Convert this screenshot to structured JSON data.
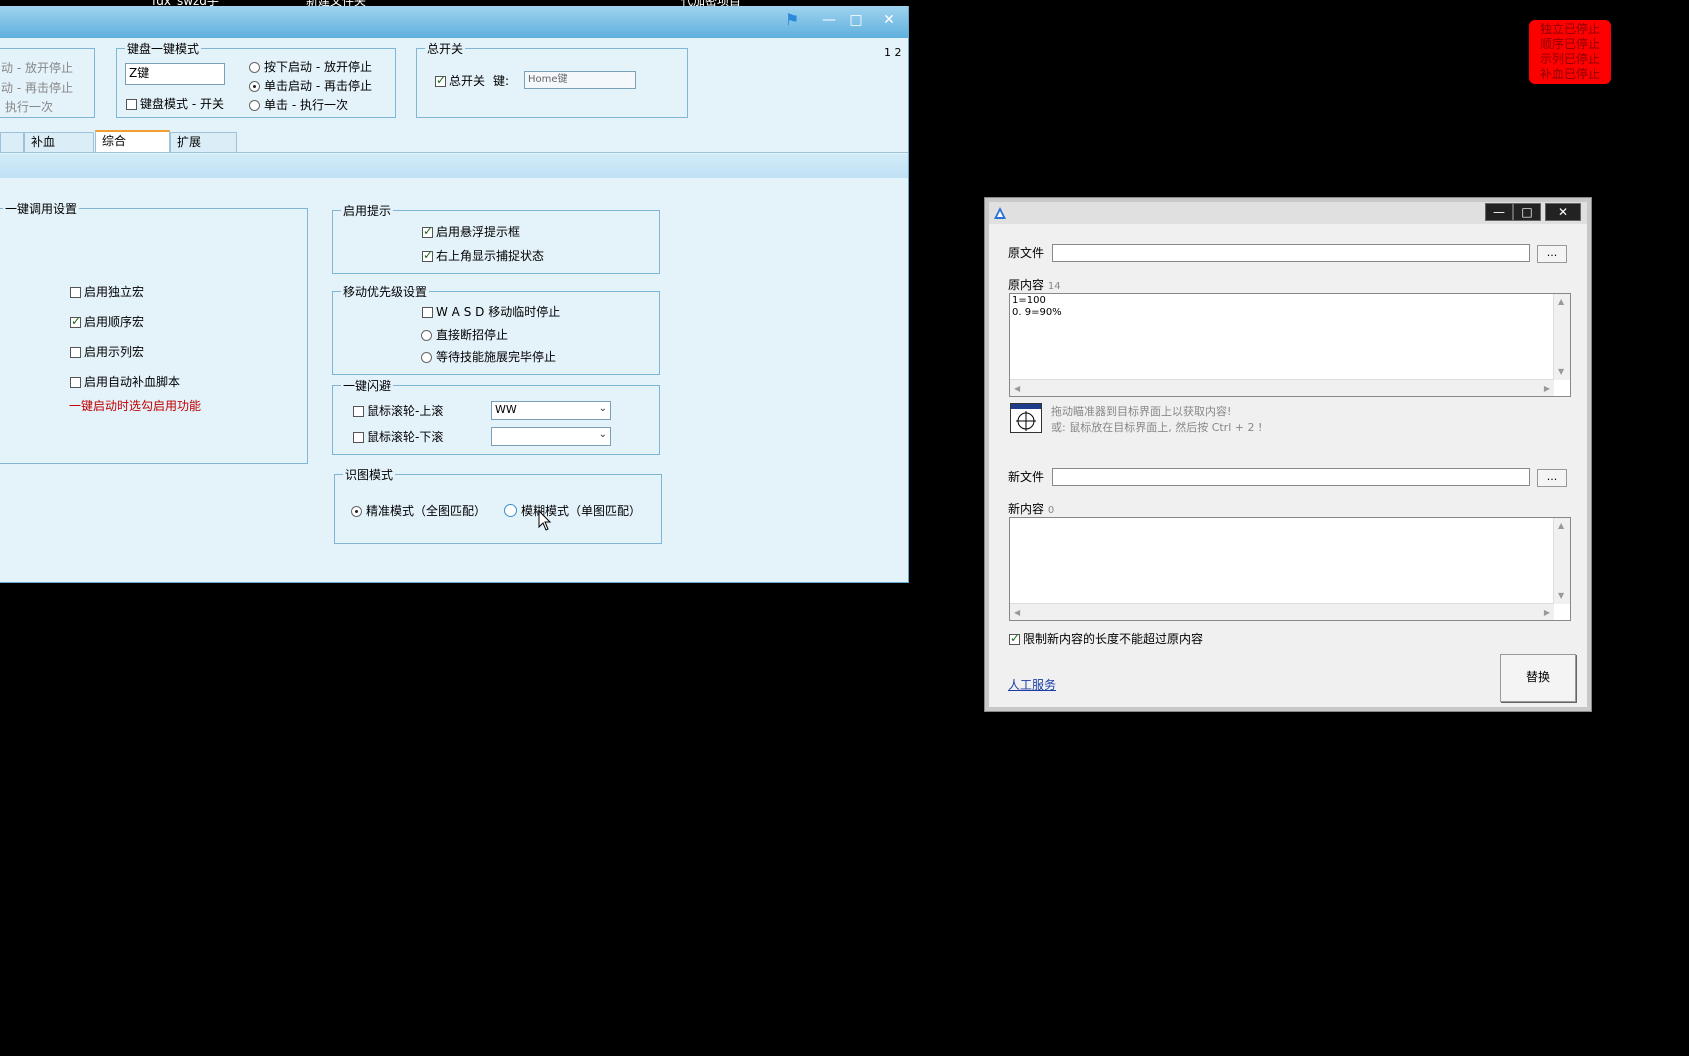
{
  "desktop": {
    "icon_labels": [
      "fdx_swzd手",
      "新建文件夹",
      "代加密项目"
    ]
  },
  "status_box": {
    "lines": [
      "独立已停止",
      "顺序已停止",
      "示列已停止",
      "补血已停止"
    ]
  },
  "main_window": {
    "page_indicator": "1 2",
    "left_group": {
      "lines": [
        "动 - 放开停止",
        "动 - 再击停止",
        "执行一次"
      ]
    },
    "keyboard_group": {
      "title": "键盘一键模式",
      "key_value": "Z键",
      "mode_checkbox": "键盘模式 - 开关",
      "mode_checked": false,
      "radio_press": "按下启动 - 放开停止",
      "radio_click": "单击启动 - 再击停止",
      "radio_once": "单击 - 执行一次",
      "selected": "radio_click"
    },
    "master_group": {
      "title": "总开关",
      "checkbox_label": "总开关",
      "checked": true,
      "key_label": "键:",
      "key_value": "Home键"
    },
    "tabs": [
      {
        "label": ""
      },
      {
        "label": "补血"
      },
      {
        "label": "综合",
        "active": true
      },
      {
        "label": "扩展"
      }
    ],
    "onekey_group": {
      "title": "一键调用设置",
      "items": [
        {
          "label": "启用独立宏",
          "checked": false
        },
        {
          "label": "启用顺序宏",
          "checked": true
        },
        {
          "label": "启用示列宏",
          "checked": false
        },
        {
          "label": "启用自动补血脚本",
          "checked": false
        }
      ],
      "note": "一键启动时选勾启用功能",
      "note_color": "#c00000"
    },
    "hint_group": {
      "title": "启用提示",
      "items": [
        {
          "label": "启用悬浮提示框",
          "checked": true
        },
        {
          "label": "右上角显示捕捉状态",
          "checked": true
        }
      ]
    },
    "move_group": {
      "title": "移动优先级设置",
      "checkbox": "W A S D 移动临时停止",
      "checkbox_checked": false,
      "radio1": "直接断招停止",
      "radio2": "等待技能施展完毕停止"
    },
    "dodge_group": {
      "title": "一键闪避",
      "up_label": "鼠标滚轮-上滚",
      "up_value": "WW",
      "down_label": "鼠标滚轮-下滚",
      "down_value": ""
    },
    "recog_group": {
      "title": "识图模式",
      "radio_exact": "精准模式（全图匹配）",
      "radio_fuzzy": "模糊模式（单图匹配）",
      "selected": "exact"
    }
  },
  "dialog": {
    "title_icon": "app-icon",
    "source_file_label": "原文件",
    "source_file_value": "",
    "browse_label": "...",
    "source_content_label": "原内容",
    "source_content_count": "14",
    "source_content_lines": [
      "1=100",
      "0. 9=90%"
    ],
    "drag_hint_line1": "拖动瞄准器到目标界面上以获取内容!",
    "drag_hint_line2": "或: 鼠标放在目标界面上, 然后按 Ctrl + 2 !",
    "new_file_label": "新文件",
    "new_file_value": "",
    "new_content_label": "新内容",
    "new_content_count": "0",
    "limit_label": "限制新内容的长度不能超过原内容",
    "limit_checked": true,
    "service_link": "人工服务",
    "replace_button": "替换"
  }
}
